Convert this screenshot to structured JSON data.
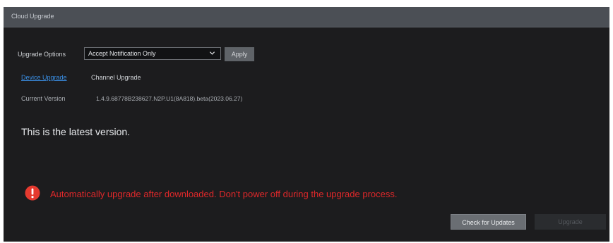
{
  "window": {
    "title": "Cloud Upgrade"
  },
  "options": {
    "label": "Upgrade Options",
    "selected": "Accept Notification Only",
    "apply_label": "Apply"
  },
  "tabs": [
    {
      "label": "Device Upgrade",
      "active": true
    },
    {
      "label": "Channel Upgrade",
      "active": false
    }
  ],
  "version": {
    "label": "Current Version",
    "value": "1.4.9.68778B238627.N2P.U1(8A818).beta(2023.06.27)"
  },
  "status": {
    "message": "This is the latest version."
  },
  "warning": {
    "icon": "alert-circle-icon",
    "text": "Automatically upgrade after downloaded. Don't power off during the upgrade process.",
    "color": "#e0282a"
  },
  "actions": {
    "check_label": "Check for Updates",
    "upgrade_label": "Upgrade",
    "upgrade_enabled": false
  },
  "colors": {
    "background": "#1c1c1e",
    "title_bar": "#4b4f55",
    "link": "#3a8fe6",
    "warning": "#e0282a"
  }
}
